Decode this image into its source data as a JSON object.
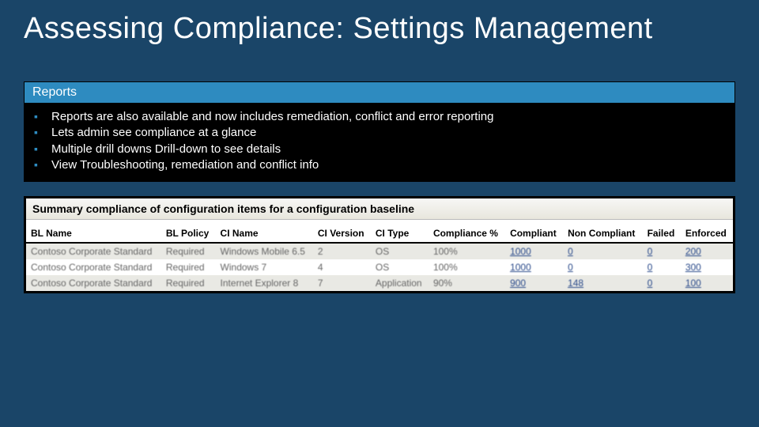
{
  "title": "Assessing Compliance: Settings Management",
  "reports": {
    "header": "Reports",
    "bullets": [
      "Reports are also available and now includes remediation, conflict and error reporting",
      "Lets admin see compliance at a glance",
      "Multiple drill downs Drill-down to see details",
      "View Troubleshooting, remediation and conflict info"
    ]
  },
  "table": {
    "title": "Summary compliance of configuration items for a configuration baseline",
    "columns": [
      "BL Name",
      "BL Policy",
      "CI Name",
      "CI Version",
      "CI Type",
      "Compliance %",
      "Compliant",
      "Non Compliant",
      "Failed",
      "Enforced"
    ],
    "rows": [
      {
        "bl_name": "Contoso Corporate Standard",
        "bl_policy": "Required",
        "ci_name": "Windows Mobile 6.5",
        "ci_version": "2",
        "ci_type": "OS",
        "compliance": "100%",
        "compliant": "1000",
        "non_compliant": "0",
        "failed": "0",
        "enforced": "200"
      },
      {
        "bl_name": "Contoso Corporate Standard",
        "bl_policy": "Required",
        "ci_name": "Windows 7",
        "ci_version": "4",
        "ci_type": "OS",
        "compliance": "100%",
        "compliant": "1000",
        "non_compliant": "0",
        "failed": "0",
        "enforced": "300"
      },
      {
        "bl_name": "Contoso Corporate Standard",
        "bl_policy": "Required",
        "ci_name": "Internet Explorer 8",
        "ci_version": "7",
        "ci_type": "Application",
        "compliance": "90%",
        "compliant": "900",
        "non_compliant": "148",
        "failed": "0",
        "enforced": "100"
      }
    ]
  }
}
